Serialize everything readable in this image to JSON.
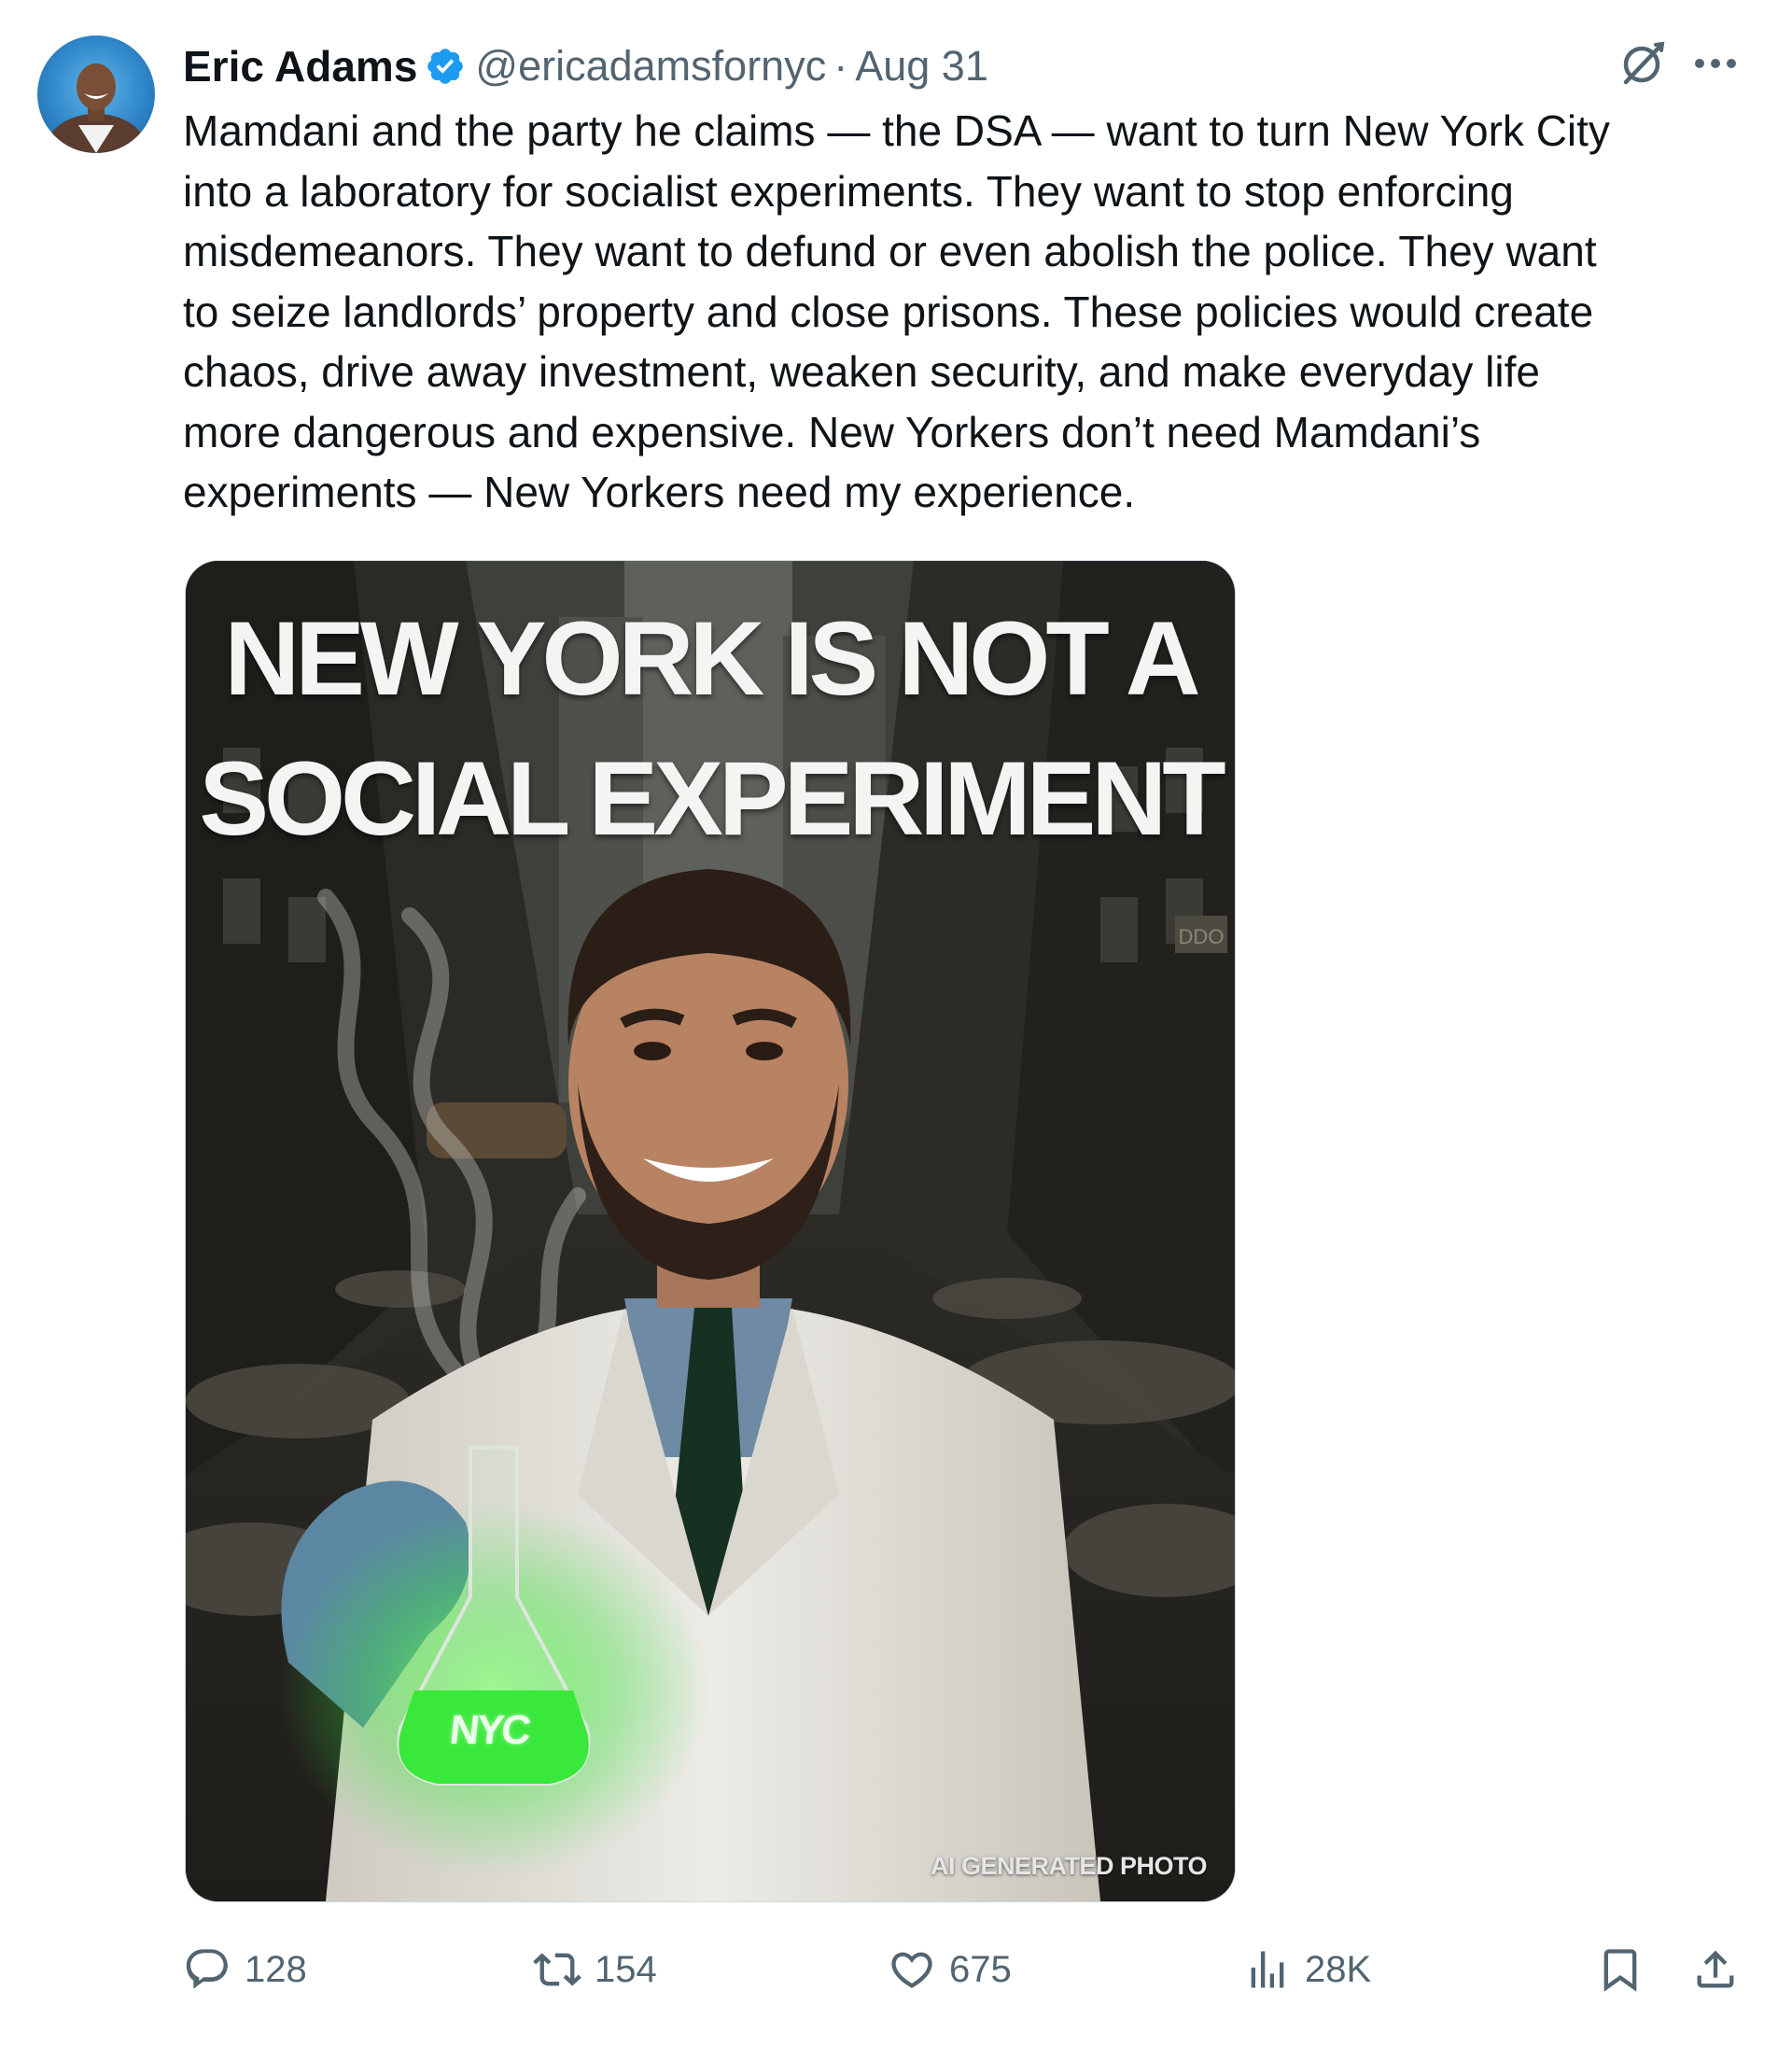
{
  "author": {
    "name": "Eric Adams",
    "handle": "@ericadamsfornyc",
    "separator": "·",
    "date": "Aug 31",
    "verified": true,
    "verified_color": "#1d9bf0"
  },
  "top_icons": [
    "grok-icon",
    "more-icon"
  ],
  "tweet_text": "Mamdani and the party he claims — the DSA — want to turn New York City\ninto a laboratory for socialist experiments. They want to stop enforcing\nmisdemeanors. They want to defund or even abolish the police. They want\nto seize landlords’ property and close prisons. These policies would create\nchaos, drive away investment, weaken security, and make everyday life\nmore dangerous and expensive. New Yorkers don’t need Mamdani’s\nexperiments — New Yorkers need my experience.",
  "media": {
    "headline_line1": "NEW YORK IS NOT A",
    "headline_line2": "SOCIAL EXPERIMENT",
    "flask_label": "NYC",
    "sign_text": "DDO",
    "watermark": "AI GENERATED PHOTO"
  },
  "actions": {
    "replies": "128",
    "reposts": "154",
    "likes": "675",
    "views": "28K"
  },
  "colors": {
    "text": "#0f1419",
    "muted": "#536471",
    "accent": "#1d9bf0",
    "flask_green": "#39e83a"
  }
}
